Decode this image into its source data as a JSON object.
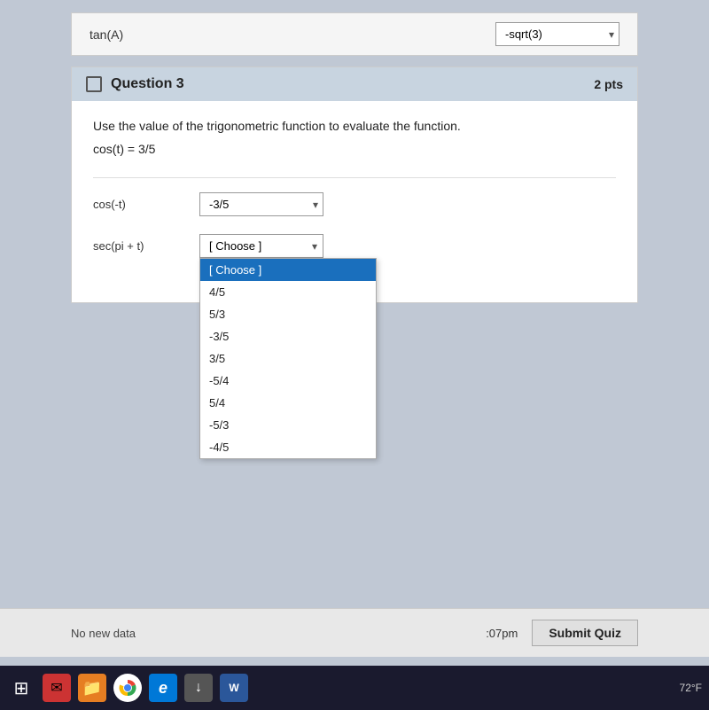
{
  "top": {
    "label": "tan(A)",
    "value": "-sqrt(3)"
  },
  "question": {
    "number": "Question 3",
    "points": "2 pts",
    "instruction": "Use the value of the trigonometric function to evaluate the function.",
    "given": "cos(t) = 3/5",
    "rows": [
      {
        "label": "cos(-t)",
        "value": "-3/5"
      },
      {
        "label": "sec(pi + t)",
        "value": "[ Choose ]"
      }
    ]
  },
  "dropdown": {
    "trigger": "[ Choose ]",
    "options": [
      {
        "label": "[ Choose ]",
        "selected": true
      },
      {
        "label": "4/5",
        "selected": false
      },
      {
        "label": "5/3",
        "selected": false
      },
      {
        "label": "-3/5",
        "selected": false
      },
      {
        "label": "3/5",
        "selected": false
      },
      {
        "label": "-5/4",
        "selected": false
      },
      {
        "label": "5/4",
        "selected": false
      },
      {
        "label": "-5/3",
        "selected": false
      },
      {
        "label": "-4/5",
        "selected": false
      }
    ]
  },
  "bottom": {
    "no_data_text": "No new data",
    "time": ":07pm",
    "submit_label": "Submit Quiz"
  },
  "taskbar": {
    "temperature": "72°F",
    "icons": [
      {
        "name": "windows-icon",
        "symbol": "⊞",
        "color": "#1a1a2e"
      },
      {
        "name": "mail-icon",
        "symbol": "✉",
        "color": "#cc3333"
      },
      {
        "name": "folder-icon",
        "symbol": "📁",
        "color": "#e67e22"
      },
      {
        "name": "chrome-icon",
        "symbol": "",
        "color": "chrome"
      },
      {
        "name": "edge-icon",
        "symbol": "e",
        "color": "#0078d7"
      },
      {
        "name": "down-icon",
        "symbol": "↓",
        "color": "#555"
      },
      {
        "name": "word-icon",
        "symbol": "W",
        "color": "#2b579a"
      }
    ]
  }
}
